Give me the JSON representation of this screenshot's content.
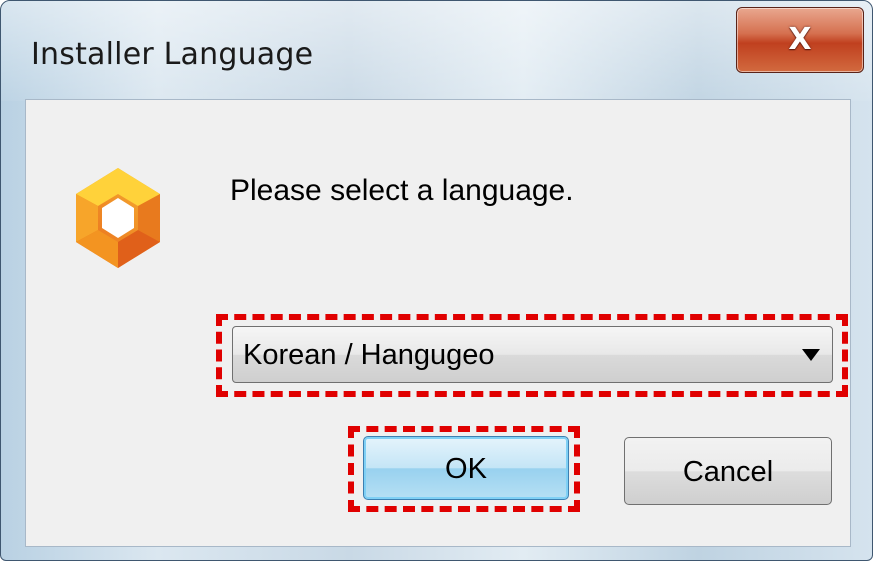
{
  "window": {
    "title": "Installer Language",
    "close_label": "X"
  },
  "dialog": {
    "prompt": "Please select a language.",
    "language_select": {
      "selected": "Korean / Hangugeo"
    },
    "ok_label": "OK",
    "cancel_label": "Cancel"
  },
  "icons": {
    "app_logo": "installer-logo-icon",
    "dropdown": "chevron-down-icon",
    "close": "close-icon"
  },
  "colors": {
    "highlight": "#e00000",
    "logo_orange": "#f29a1f",
    "logo_yellow": "#ffd23a",
    "close_red": "#c0401f",
    "ok_blue": "#98d1ef"
  }
}
